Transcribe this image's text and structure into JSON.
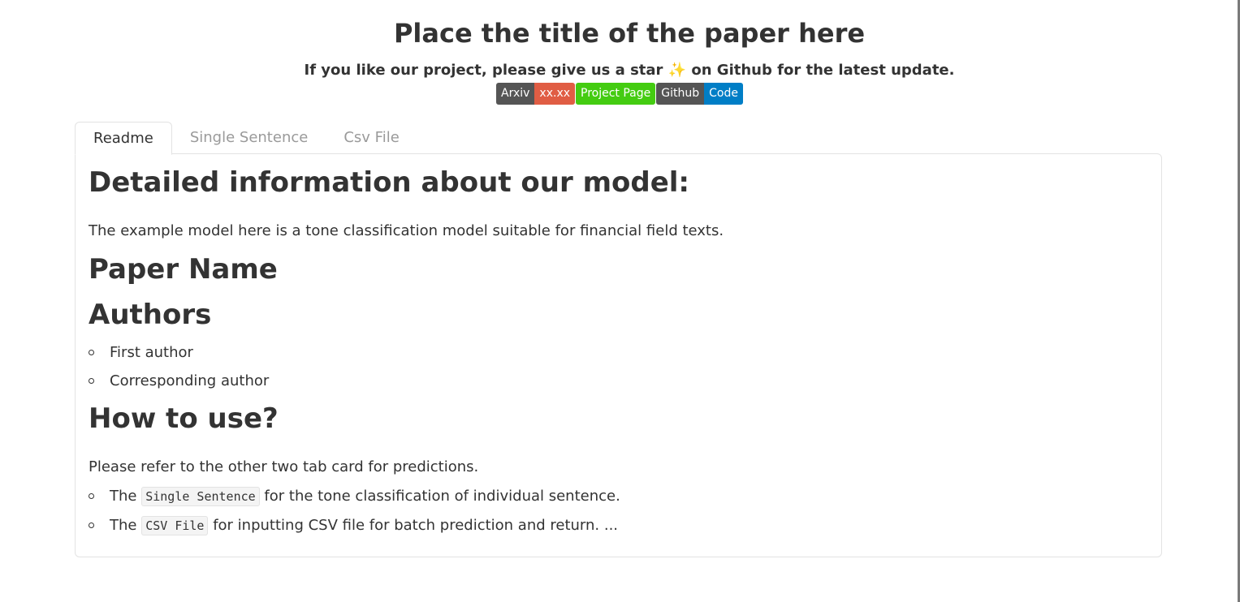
{
  "header": {
    "title": "Place the title of the paper here",
    "subtitle": "If you like our project, please give us a star ✨ on Github for the latest update."
  },
  "badges": [
    {
      "left": "Arxiv",
      "right": "xx.xx",
      "right_color": "#e05d44"
    },
    {
      "single": "Project Page",
      "color": "#44cc11"
    },
    {
      "left": "Github",
      "right": "Code",
      "right_color": "#007ec6"
    }
  ],
  "tabs": [
    {
      "label": "Readme",
      "active": true
    },
    {
      "label": "Single Sentence",
      "active": false
    },
    {
      "label": "Csv File",
      "active": false
    }
  ],
  "readme": {
    "heading1": "Detailed information about our model:",
    "intro": "The example model here is a tone classification model suitable for financial field texts.",
    "heading2": "Paper Name",
    "heading3": "Authors",
    "authors": [
      "First author",
      "Corresponding author"
    ],
    "heading4": "How to use?",
    "usage_intro": "Please refer to the other two tab card for predictions.",
    "usage_items": [
      {
        "prefix": "The",
        "code": "Single Sentence",
        "suffix": "for the tone classification of individual sentence."
      },
      {
        "prefix": "The",
        "code": "CSV File",
        "suffix": "for inputting CSV file for batch prediction and return. ..."
      }
    ]
  }
}
